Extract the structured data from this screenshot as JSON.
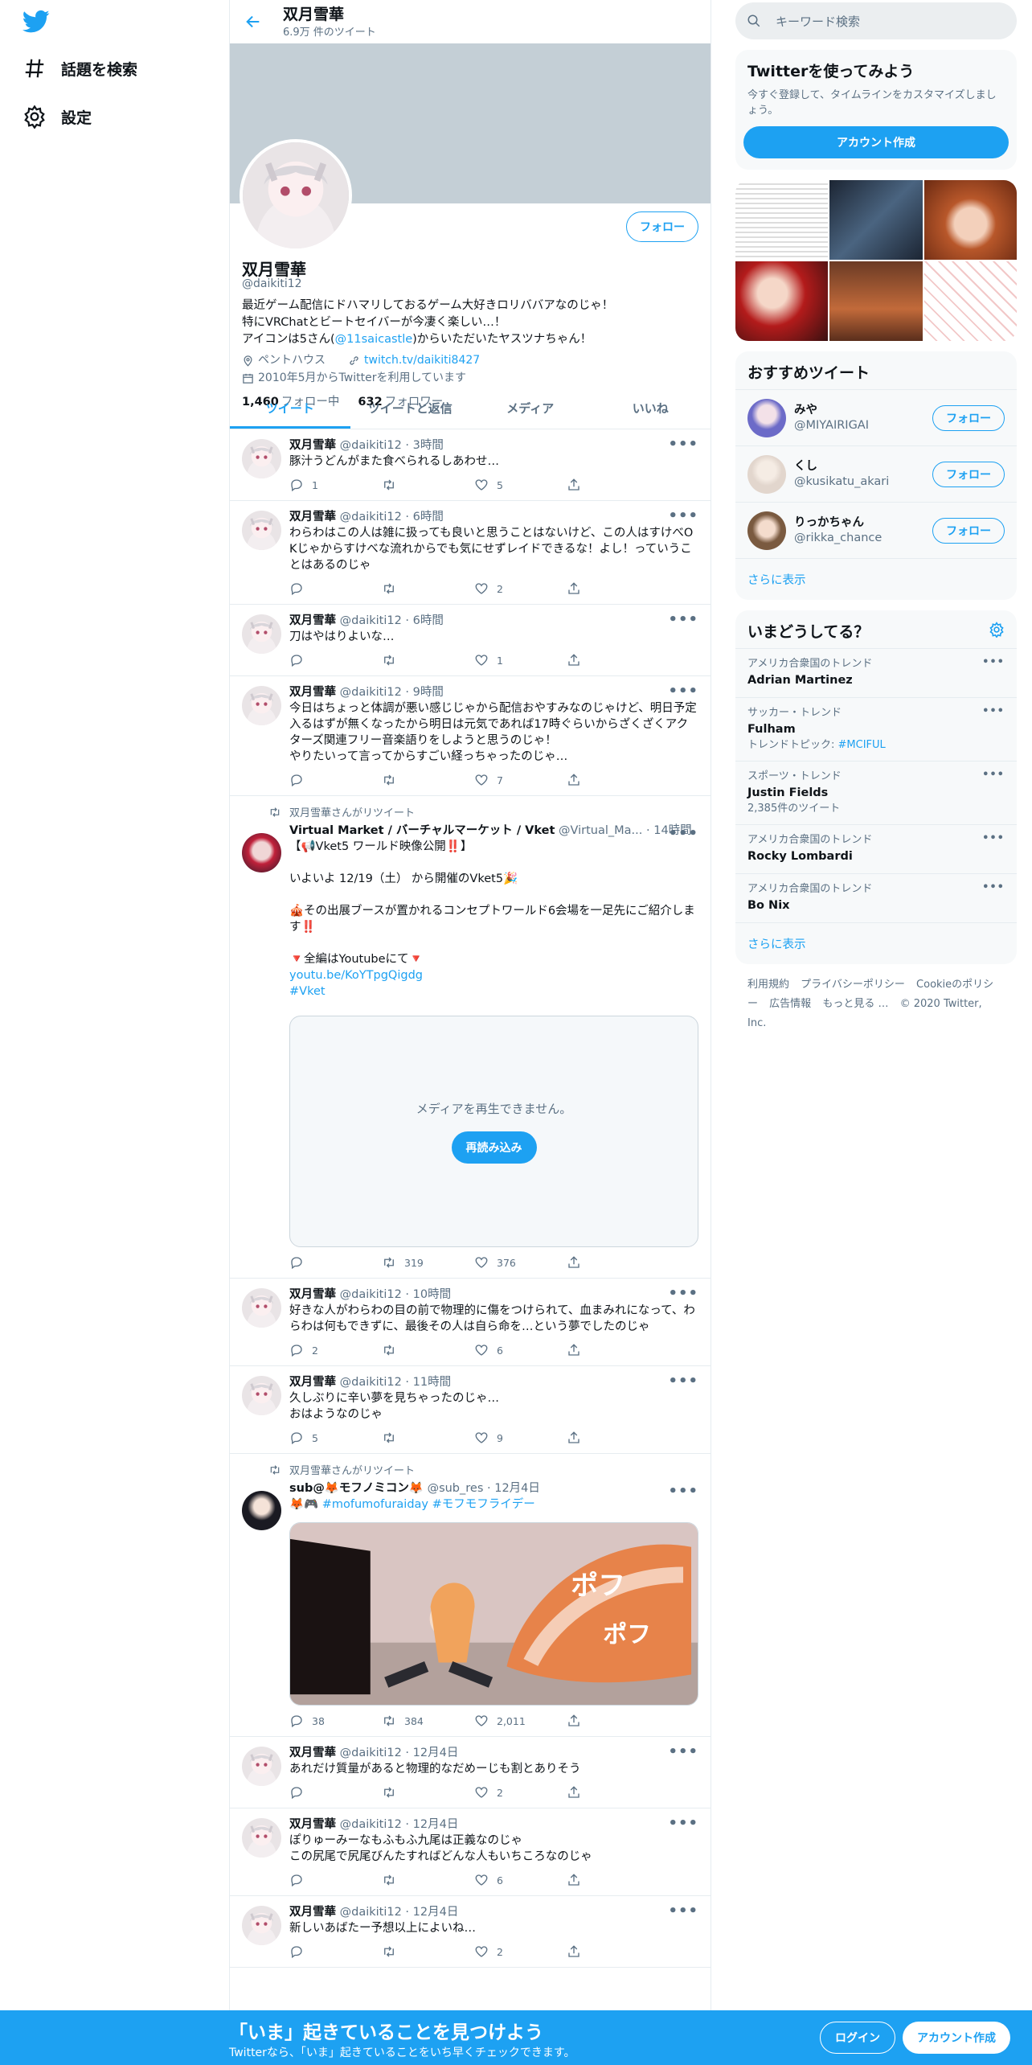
{
  "nav": {
    "explore": "話題を検索",
    "settings": "設定"
  },
  "header": {
    "name": "双月雪華",
    "tweets": "6.9万 件のツイート"
  },
  "profile": {
    "follow": "フォロー",
    "name": "双月雪華",
    "handle": "@daikiti12",
    "bio1": "最近ゲーム配信にドハマリしておるゲーム大好きロリババアなのじゃ！",
    "bio2": "特にVRChatとビートセイバーが今凄く楽しい…！",
    "bio3a": "アイコンは5さん(",
    "bio3link": "@11saicastle",
    "bio3b": ")からいただいたヤスツナちゃん！",
    "location": "ペントハウス",
    "url": "twitch.tv/daikiti8427",
    "joined": "2010年5月からTwitterを利用しています",
    "following_n": "1,460",
    "following_l": "フォロー中",
    "followers_n": "632",
    "followers_l": "フォロワー"
  },
  "tabs": [
    "ツイート",
    "ツイートと返信",
    "メディア",
    "いいね"
  ],
  "tweets": [
    {
      "name": "双月雪華",
      "handle": "@daikiti12",
      "time": "3時間",
      "text": "豚汁うどんがまた食べられるしあわせ…",
      "reply": "1",
      "rt": "",
      "like": "5"
    },
    {
      "name": "双月雪華",
      "handle": "@daikiti12",
      "time": "6時間",
      "text": "わらわはこの人は雑に扱っても良いと思うことはないけど、この人はすけべOKじゃからすけべな流れからでも気にせずレイドできるな！よし！っていうことはあるのじゃ",
      "reply": "",
      "rt": "",
      "like": "2"
    },
    {
      "name": "双月雪華",
      "handle": "@daikiti12",
      "time": "6時間",
      "text": "刀はやはりよいな…",
      "reply": "",
      "rt": "",
      "like": "1"
    },
    {
      "name": "双月雪華",
      "handle": "@daikiti12",
      "time": "9時間",
      "text": "今日はちょっと体調が悪い感じじゃから配信おやすみなのじゃけど、明日予定入るはずが無くなったから明日は元気であれば17時ぐらいからざくざくアクターズ関連フリー音楽語りをしようと思うのじゃ！\nやりたいって言ってからすごい経っちゃったのじゃ…",
      "reply": "",
      "rt": "",
      "like": "7"
    },
    {
      "retweeted": "双月雪華さんがリツイート",
      "name": "Virtual Market / バーチャルマーケット / Vket",
      "handle": "@Virtual_Ma...",
      "time": "14時間",
      "text": "【📢Vket5 ワールド映像公開‼️】\n\nいよいよ 12/19（土） から開催のVket5🎉\n\n🎪その出展ブースが置かれるコンセプトワールド6会場を一足先にご紹介します‼️\n\n🔻全編はYoutubeにて🔻",
      "link": "youtu.be/KoYTpgQigdg",
      "tag": "#Vket",
      "media_msg": "メディアを再生できません。",
      "media_btn": "再読み込み",
      "reply": "",
      "rt": "319",
      "like": "376"
    },
    {
      "name": "双月雪華",
      "handle": "@daikiti12",
      "time": "10時間",
      "text": "好きな人がわらわの目の前で物理的に傷をつけられて、血まみれになって、わらわは何もできずに、最後その人は自ら命を…という夢でしたのじゃ",
      "reply": "2",
      "rt": "",
      "like": "6"
    },
    {
      "name": "双月雪華",
      "handle": "@daikiti12",
      "time": "11時間",
      "text": "久しぶりに辛い夢を見ちゃったのじゃ…\nおはようなのじゃ",
      "reply": "5",
      "rt": "",
      "like": "9"
    },
    {
      "retweeted": "双月雪華さんがリツイート",
      "name": "sub@🦊モフノミコン🦊",
      "handle": "@sub_res",
      "time": "12月4日",
      "pre": "🦊🎮 ",
      "tag": "#mofumofuraiday #モフモフライデー",
      "reply": "38",
      "rt": "384",
      "like": "2,011"
    },
    {
      "name": "双月雪華",
      "handle": "@daikiti12",
      "time": "12月4日",
      "text": "あれだけ質量があると物理的なだめーじも割とありそう",
      "reply": "",
      "rt": "",
      "like": "2"
    },
    {
      "name": "双月雪華",
      "handle": "@daikiti12",
      "time": "12月4日",
      "text": "ぽりゅーみーなもふもふ九尾は正義なのじゃ\nこの尻尾で尻尾びんたすればどんな人もいちころなのじゃ",
      "reply": "",
      "rt": "",
      "like": "6"
    },
    {
      "name": "双月雪華",
      "handle": "@daikiti12",
      "time": "12月4日",
      "text": "新しいあばたー予想以上によいね…",
      "reply": "",
      "rt": "",
      "like": "2"
    }
  ],
  "right": {
    "search_ph": "キーワード検索",
    "signup_title": "Twitterを使ってみよう",
    "signup_text": "今すぐ登録して、タイムラインをカスタマイズしましょう。",
    "signup_btn": "アカウント作成",
    "rec_title": "おすすめツイート",
    "recs": [
      {
        "name": "みや",
        "handle": "@MIYAIRIGAI",
        "btn": "フォロー"
      },
      {
        "name": "くし",
        "handle": "@kusikatu_akari",
        "btn": "フォロー"
      },
      {
        "name": "りっかちゃん",
        "handle": "@rikka_chance",
        "btn": "フォロー"
      }
    ],
    "more": "さらに表示",
    "trend_title": "いまどうしてる？",
    "trends": [
      {
        "ctx": "アメリカ合衆国のトレンド",
        "name": "Adrian Martinez",
        "sub": ""
      },
      {
        "ctx": "サッカー・トレンド",
        "name": "Fulham",
        "sub": "トレンドトピック: ",
        "subtag": "#MCIFUL"
      },
      {
        "ctx": "スポーツ・トレンド",
        "name": "Justin Fields",
        "sub": "2,385件のツイート"
      },
      {
        "ctx": "アメリカ合衆国のトレンド",
        "name": "Rocky Lombardi",
        "sub": ""
      },
      {
        "ctx": "アメリカ合衆国のトレンド",
        "name": "Bo Nix",
        "sub": ""
      }
    ],
    "footer": [
      "利用規約",
      "プライバシーポリシー",
      "Cookieのポリシー",
      "広告情報",
      "もっと見る …",
      "© 2020 Twitter, Inc."
    ]
  },
  "bottom": {
    "title": "「いま」起きていることを見つけよう",
    "sub": "Twitterなら、「いま」起きていることをいち早くチェックできます。",
    "login": "ログイン",
    "signup": "アカウント作成"
  },
  "colors": {
    "accent": "#1da1f2",
    "banner": "#c4cfd6"
  }
}
